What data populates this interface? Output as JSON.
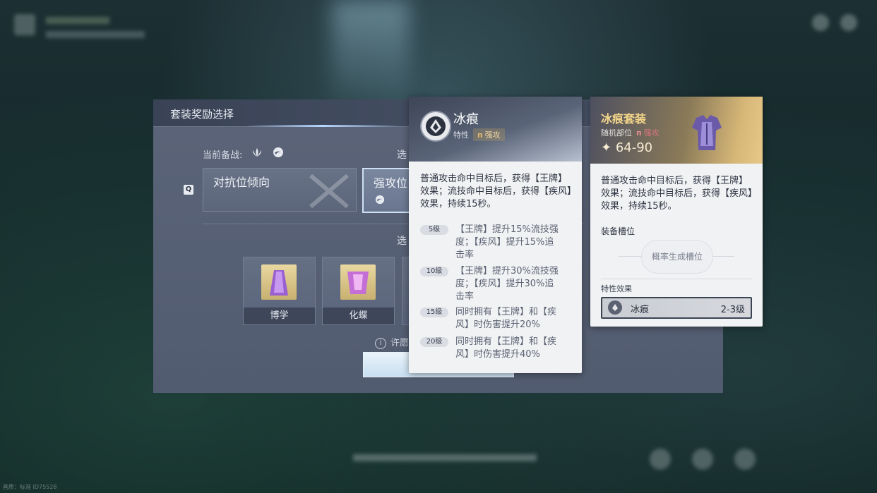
{
  "dialog": {
    "title": "套装奖励选择",
    "current_label": "当前备战:",
    "select_label_1": "选",
    "select_label_2": "选",
    "q_key": "Q",
    "options": [
      {
        "label": "对抗位倾向"
      },
      {
        "label": "强攻位"
      }
    ],
    "items": [
      {
        "name": "博学"
      },
      {
        "name": "化蝶"
      }
    ],
    "info_text": "许愿"
  },
  "tooltip_trait": {
    "name": "冰痕",
    "trait_label": "特性",
    "tag": "强攻",
    "description": "普通攻击命中目标后，获得【王牌】效果；流技命中目标后，获得【疾风】效果，持续15秒。",
    "levels": [
      {
        "level": "5级",
        "text": "【王牌】提升15%流技强度；【疾风】提升15%追击率"
      },
      {
        "level": "10级",
        "text": "【王牌】提升30%流技强度；【疾风】提升30%追击率"
      },
      {
        "level": "15级",
        "text": "同时拥有【王牌】和【疾风】时伤害提升20%"
      },
      {
        "level": "20级",
        "text": "同时拥有【王牌】和【疾风】时伤害提升40%"
      }
    ]
  },
  "tooltip_set": {
    "name": "冰痕套装",
    "slot_type": "随机部位",
    "tag": "强攻",
    "range": "64-90",
    "description": "普通攻击命中目标后，获得【王牌】效果；流技命中目标后，获得【疾风】效果，持续15秒。",
    "slot_title": "装备槽位",
    "slot_pill": "概率生成槽位",
    "trait_effect_title": "特性效果",
    "trait_name": "冰痕",
    "trait_levels": "2-3级"
  },
  "footer": {
    "id_text": "画质：标准 ID75528"
  },
  "colors": {
    "set_name": "#f4d68a",
    "tag_red": "#d9747a",
    "tag_gold": "#f0d6a0"
  }
}
